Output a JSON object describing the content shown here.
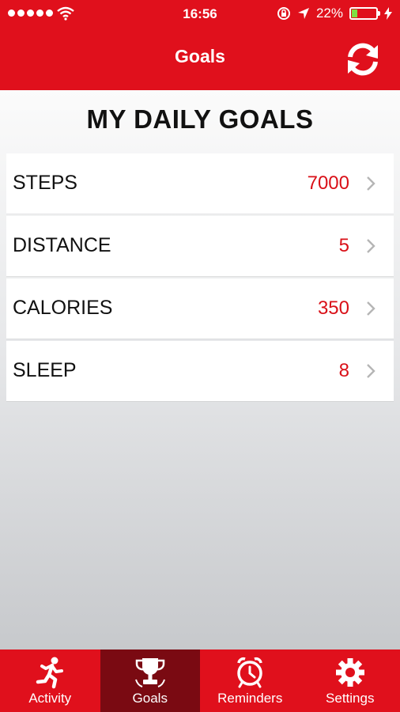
{
  "status_bar": {
    "time": "16:56",
    "battery_percent": "22%",
    "battery_level": 0.22,
    "battery_color": "#7ee043"
  },
  "header": {
    "title": "Goals",
    "sync_icon": "refresh-icon"
  },
  "main": {
    "title": "MY DAILY GOALS",
    "goals": [
      {
        "label": "STEPS",
        "value": "7000"
      },
      {
        "label": "DISTANCE",
        "value": "5"
      },
      {
        "label": "CALORIES",
        "value": "350"
      },
      {
        "label": "SLEEP",
        "value": "8"
      }
    ]
  },
  "tabs": [
    {
      "label": "Activity",
      "icon": "runner-icon",
      "active": false
    },
    {
      "label": "Goals",
      "icon": "trophy-icon",
      "active": true
    },
    {
      "label": "Reminders",
      "icon": "alarm-clock-icon",
      "active": false
    },
    {
      "label": "Settings",
      "icon": "gear-icon",
      "active": false
    }
  ],
  "colors": {
    "brand_red": "#e0101c",
    "active_tab": "#7a0a12",
    "goal_value": "#d91018"
  }
}
